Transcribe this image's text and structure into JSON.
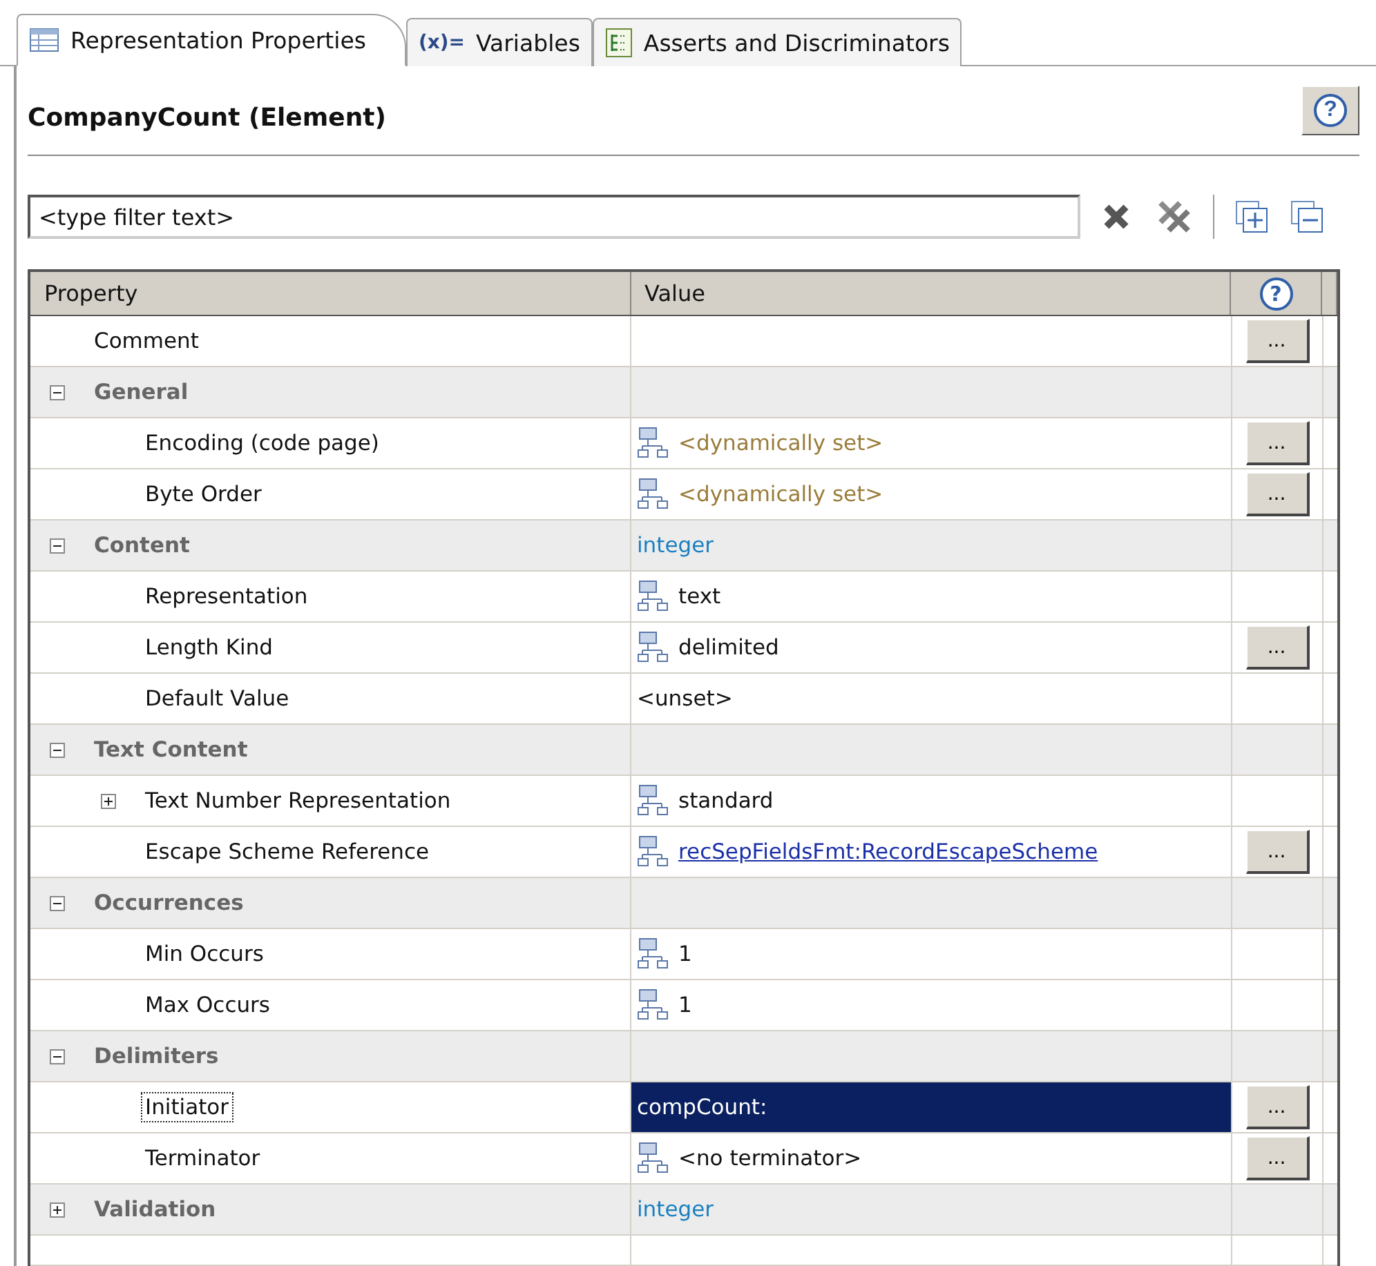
{
  "tabs": [
    {
      "label": "Representation Properties",
      "kind": "table",
      "selected": true
    },
    {
      "label": "Variables",
      "kind": "variables",
      "glyph": "(x)=",
      "selected": false
    },
    {
      "label": "Asserts and Discriminators",
      "kind": "asserts",
      "selected": false
    }
  ],
  "title": "CompanyCount (Element)",
  "help_button": "?",
  "filter": {
    "placeholder": "<type filter text>"
  },
  "table": {
    "columns": [
      "Property",
      "Value"
    ],
    "help_column": "?",
    "rows": [
      {
        "label": "Comment",
        "kind": "property",
        "button": "...",
        "selected": false
      },
      {
        "label": "General",
        "kind": "category",
        "expanded": true,
        "children": [
          {
            "label": "Encoding (code page)",
            "kind": "property",
            "value": {
              "text": "<dynamically set>",
              "kind": "dynamic"
            },
            "icon": true,
            "button": "...",
            "selected": false
          },
          {
            "label": "Byte Order",
            "kind": "property",
            "value": {
              "text": "<dynamically set>",
              "kind": "dynamic"
            },
            "icon": true,
            "button": "...",
            "selected": false
          }
        ]
      },
      {
        "label": "Content",
        "kind": "category",
        "expanded": true,
        "value": {
          "text": "integer",
          "kind": "type"
        },
        "children": [
          {
            "label": "Representation",
            "kind": "property",
            "value": {
              "text": "text",
              "kind": "plain"
            },
            "icon": true,
            "selected": false
          },
          {
            "label": "Length Kind",
            "kind": "property",
            "value": {
              "text": "delimited",
              "kind": "plain"
            },
            "icon": true,
            "button": "...",
            "selected": false
          },
          {
            "label": "Default Value",
            "kind": "property",
            "value": {
              "text": "<unset>",
              "kind": "plain"
            },
            "icon": false,
            "selected": false
          }
        ]
      },
      {
        "label": "Text Content",
        "kind": "category",
        "expanded": true,
        "children": [
          {
            "label": "Text Number Representation",
            "kind": "property",
            "expandable": true,
            "expanded": false,
            "value": {
              "text": "standard",
              "kind": "plain"
            },
            "icon": true,
            "selected": false
          },
          {
            "label": "Escape Scheme Reference",
            "kind": "property",
            "value": {
              "text": "recSepFieldsFmt:RecordEscapeScheme",
              "kind": "link"
            },
            "icon": true,
            "button": "...",
            "selected": false
          }
        ]
      },
      {
        "label": "Occurrences",
        "kind": "category",
        "expanded": true,
        "children": [
          {
            "label": "Min Occurs",
            "kind": "property",
            "value": {
              "text": "1",
              "kind": "plain"
            },
            "icon": true,
            "selected": false
          },
          {
            "label": "Max Occurs",
            "kind": "property",
            "value": {
              "text": "1",
              "kind": "plain"
            },
            "icon": true,
            "selected": false
          }
        ]
      },
      {
        "label": "Delimiters",
        "kind": "category",
        "expanded": true,
        "children": [
          {
            "label": "Initiator",
            "kind": "property",
            "value": {
              "text": "compCount:",
              "kind": "plain"
            },
            "icon": false,
            "button": "...",
            "selected": true
          },
          {
            "label": "Terminator",
            "kind": "property",
            "value": {
              "text": "<no terminator>",
              "kind": "plain"
            },
            "icon": true,
            "button": "...",
            "selected": false
          }
        ]
      },
      {
        "label": "Validation",
        "kind": "category",
        "expanded": false,
        "value": {
          "text": "integer",
          "kind": "type"
        }
      }
    ]
  }
}
